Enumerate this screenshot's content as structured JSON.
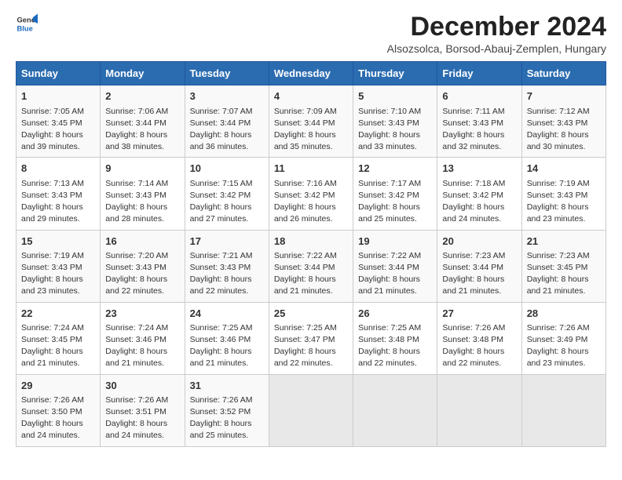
{
  "logo": {
    "general": "General",
    "blue": "Blue"
  },
  "title": "December 2024",
  "subtitle": "Alsozsolca, Borsod-Abauj-Zemplen, Hungary",
  "headers": [
    "Sunday",
    "Monday",
    "Tuesday",
    "Wednesday",
    "Thursday",
    "Friday",
    "Saturday"
  ],
  "weeks": [
    [
      {
        "day": "1",
        "info": "Sunrise: 7:05 AM\nSunset: 3:45 PM\nDaylight: 8 hours\nand 39 minutes."
      },
      {
        "day": "2",
        "info": "Sunrise: 7:06 AM\nSunset: 3:44 PM\nDaylight: 8 hours\nand 38 minutes."
      },
      {
        "day": "3",
        "info": "Sunrise: 7:07 AM\nSunset: 3:44 PM\nDaylight: 8 hours\nand 36 minutes."
      },
      {
        "day": "4",
        "info": "Sunrise: 7:09 AM\nSunset: 3:44 PM\nDaylight: 8 hours\nand 35 minutes."
      },
      {
        "day": "5",
        "info": "Sunrise: 7:10 AM\nSunset: 3:43 PM\nDaylight: 8 hours\nand 33 minutes."
      },
      {
        "day": "6",
        "info": "Sunrise: 7:11 AM\nSunset: 3:43 PM\nDaylight: 8 hours\nand 32 minutes."
      },
      {
        "day": "7",
        "info": "Sunrise: 7:12 AM\nSunset: 3:43 PM\nDaylight: 8 hours\nand 30 minutes."
      }
    ],
    [
      {
        "day": "8",
        "info": "Sunrise: 7:13 AM\nSunset: 3:43 PM\nDaylight: 8 hours\nand 29 minutes."
      },
      {
        "day": "9",
        "info": "Sunrise: 7:14 AM\nSunset: 3:43 PM\nDaylight: 8 hours\nand 28 minutes."
      },
      {
        "day": "10",
        "info": "Sunrise: 7:15 AM\nSunset: 3:42 PM\nDaylight: 8 hours\nand 27 minutes."
      },
      {
        "day": "11",
        "info": "Sunrise: 7:16 AM\nSunset: 3:42 PM\nDaylight: 8 hours\nand 26 minutes."
      },
      {
        "day": "12",
        "info": "Sunrise: 7:17 AM\nSunset: 3:42 PM\nDaylight: 8 hours\nand 25 minutes."
      },
      {
        "day": "13",
        "info": "Sunrise: 7:18 AM\nSunset: 3:42 PM\nDaylight: 8 hours\nand 24 minutes."
      },
      {
        "day": "14",
        "info": "Sunrise: 7:19 AM\nSunset: 3:43 PM\nDaylight: 8 hours\nand 23 minutes."
      }
    ],
    [
      {
        "day": "15",
        "info": "Sunrise: 7:19 AM\nSunset: 3:43 PM\nDaylight: 8 hours\nand 23 minutes."
      },
      {
        "day": "16",
        "info": "Sunrise: 7:20 AM\nSunset: 3:43 PM\nDaylight: 8 hours\nand 22 minutes."
      },
      {
        "day": "17",
        "info": "Sunrise: 7:21 AM\nSunset: 3:43 PM\nDaylight: 8 hours\nand 22 minutes."
      },
      {
        "day": "18",
        "info": "Sunrise: 7:22 AM\nSunset: 3:44 PM\nDaylight: 8 hours\nand 21 minutes."
      },
      {
        "day": "19",
        "info": "Sunrise: 7:22 AM\nSunset: 3:44 PM\nDaylight: 8 hours\nand 21 minutes."
      },
      {
        "day": "20",
        "info": "Sunrise: 7:23 AM\nSunset: 3:44 PM\nDaylight: 8 hours\nand 21 minutes."
      },
      {
        "day": "21",
        "info": "Sunrise: 7:23 AM\nSunset: 3:45 PM\nDaylight: 8 hours\nand 21 minutes."
      }
    ],
    [
      {
        "day": "22",
        "info": "Sunrise: 7:24 AM\nSunset: 3:45 PM\nDaylight: 8 hours\nand 21 minutes."
      },
      {
        "day": "23",
        "info": "Sunrise: 7:24 AM\nSunset: 3:46 PM\nDaylight: 8 hours\nand 21 minutes."
      },
      {
        "day": "24",
        "info": "Sunrise: 7:25 AM\nSunset: 3:46 PM\nDaylight: 8 hours\nand 21 minutes."
      },
      {
        "day": "25",
        "info": "Sunrise: 7:25 AM\nSunset: 3:47 PM\nDaylight: 8 hours\nand 22 minutes."
      },
      {
        "day": "26",
        "info": "Sunrise: 7:25 AM\nSunset: 3:48 PM\nDaylight: 8 hours\nand 22 minutes."
      },
      {
        "day": "27",
        "info": "Sunrise: 7:26 AM\nSunset: 3:48 PM\nDaylight: 8 hours\nand 22 minutes."
      },
      {
        "day": "28",
        "info": "Sunrise: 7:26 AM\nSunset: 3:49 PM\nDaylight: 8 hours\nand 23 minutes."
      }
    ],
    [
      {
        "day": "29",
        "info": "Sunrise: 7:26 AM\nSunset: 3:50 PM\nDaylight: 8 hours\nand 24 minutes."
      },
      {
        "day": "30",
        "info": "Sunrise: 7:26 AM\nSunset: 3:51 PM\nDaylight: 8 hours\nand 24 minutes."
      },
      {
        "day": "31",
        "info": "Sunrise: 7:26 AM\nSunset: 3:52 PM\nDaylight: 8 hours\nand 25 minutes."
      },
      {
        "day": "",
        "info": ""
      },
      {
        "day": "",
        "info": ""
      },
      {
        "day": "",
        "info": ""
      },
      {
        "day": "",
        "info": ""
      }
    ]
  ]
}
